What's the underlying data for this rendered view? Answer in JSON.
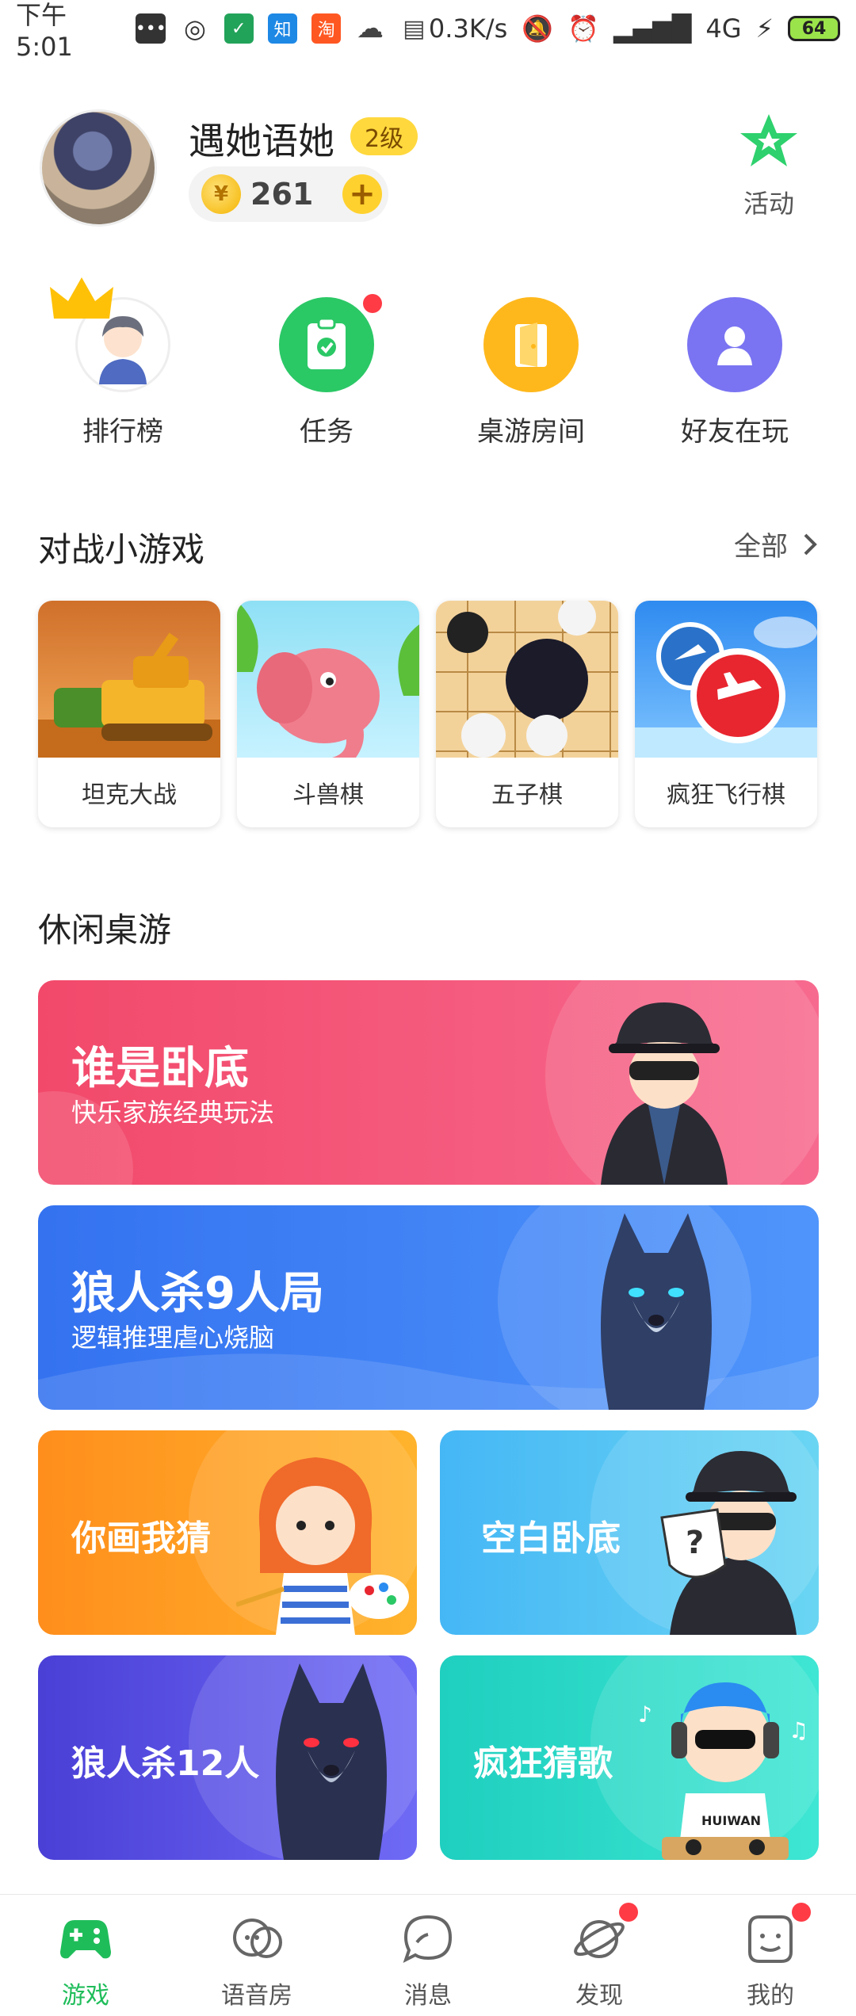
{
  "status_bar": {
    "time": "下午5:01",
    "speed": "0.3K/s",
    "network": "4G",
    "battery": "64",
    "app_icons": [
      "message-icon",
      "wechat-icon",
      "app-icon",
      "zhihu-icon",
      "taobao-icon",
      "cloud-icon",
      "doc-icon"
    ],
    "zhihu_label": "知",
    "taobao_label": "淘"
  },
  "profile": {
    "username": "遇她语她",
    "level": "2级",
    "coins": "261",
    "activity_label": "活动"
  },
  "shortcuts": [
    {
      "label": "排行榜"
    },
    {
      "label": "任务"
    },
    {
      "label": "桌游房间"
    },
    {
      "label": "好友在玩"
    }
  ],
  "mini_games_section": {
    "title": "对战小游戏",
    "more": "全部",
    "games": [
      {
        "name": "坦克大战"
      },
      {
        "name": "斗兽棋"
      },
      {
        "name": "五子棋"
      },
      {
        "name": "疯狂飞行棋"
      }
    ]
  },
  "casual_section": {
    "title": "休闲桌游",
    "cards": [
      {
        "title": "谁是卧底",
        "subtitle": "快乐家族经典玩法",
        "color": "#f25b7a"
      },
      {
        "title": "狼人杀9人局",
        "subtitle": "逻辑推理虐心烧脑",
        "color": "#3d7ff5"
      },
      {
        "title": "你画我猜",
        "color": "#ffa21f"
      },
      {
        "title": "空白卧底",
        "color": "#4fc3f7"
      },
      {
        "title": "狼人杀12人",
        "color": "#5a55e0"
      },
      {
        "title": "疯狂猜歌",
        "color": "#2ad8c6"
      }
    ]
  },
  "bottom_nav": [
    {
      "label": "游戏",
      "active": true
    },
    {
      "label": "语音房"
    },
    {
      "label": "消息"
    },
    {
      "label": "发现"
    },
    {
      "label": "我的"
    }
  ]
}
